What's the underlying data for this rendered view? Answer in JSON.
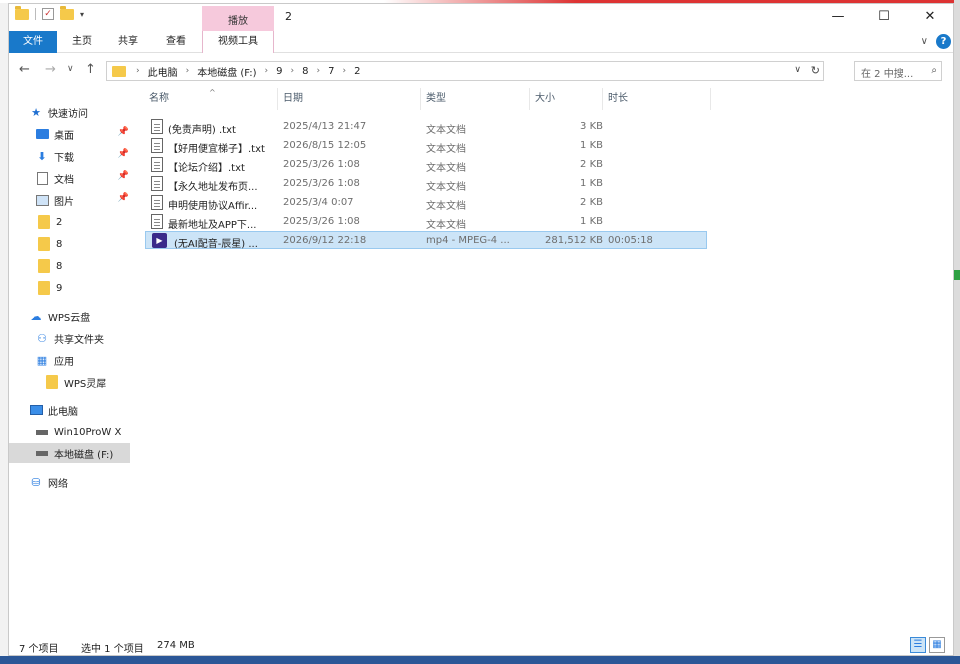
{
  "titlebar": {
    "tool_tab_header": "播放",
    "title": "2",
    "minimize": "—",
    "maximize": "☐",
    "close": "✕"
  },
  "ribbon": {
    "tabs": [
      {
        "label": "文件",
        "kind": "file"
      },
      {
        "label": "主页",
        "kind": "normal"
      },
      {
        "label": "共享",
        "kind": "normal"
      },
      {
        "label": "查看",
        "kind": "normal"
      },
      {
        "label": "视频工具",
        "kind": "tool"
      }
    ],
    "collapse_chevron": "∨",
    "help": "?"
  },
  "navbar": {
    "back": "←",
    "forward": "→",
    "recent": "∨",
    "up": "↑",
    "breadcrumb": [
      "此电脑",
      "本地磁盘 (F:)",
      "9",
      "8",
      "7",
      "2"
    ],
    "search_placeholder": "在 2 中搜..."
  },
  "sidebar": {
    "items": [
      {
        "label": "快速访问",
        "icon": "star-icon",
        "pinned": false,
        "indent": 0
      },
      {
        "label": "桌面",
        "icon": "desktop-icon",
        "pinned": true,
        "indent": 1
      },
      {
        "label": "下载",
        "icon": "download-icon",
        "pinned": true,
        "indent": 1
      },
      {
        "label": "文档",
        "icon": "document-icon",
        "pinned": true,
        "indent": 1
      },
      {
        "label": "图片",
        "icon": "picture-icon",
        "pinned": true,
        "indent": 1
      },
      {
        "label": "2",
        "icon": "folder-icon",
        "pinned": false,
        "indent": 1
      },
      {
        "label": "8",
        "icon": "folder-icon",
        "pinned": false,
        "indent": 1
      },
      {
        "label": "8",
        "icon": "folder-icon",
        "pinned": false,
        "indent": 1
      },
      {
        "label": "9",
        "icon": "folder-icon",
        "pinned": false,
        "indent": 1
      },
      {
        "label": "WPS云盘",
        "icon": "cloud-icon",
        "pinned": false,
        "indent": 0
      },
      {
        "label": "共享文件夹",
        "icon": "share-icon",
        "pinned": false,
        "indent": 1
      },
      {
        "label": "应用",
        "icon": "apps-icon",
        "pinned": false,
        "indent": 1
      },
      {
        "label": "WPS灵犀",
        "icon": "folder-icon",
        "pinned": false,
        "indent": 2
      },
      {
        "label": "此电脑",
        "icon": "computer-icon",
        "pinned": false,
        "indent": 0
      },
      {
        "label": "Win10ProW X",
        "icon": "drive-icon",
        "pinned": false,
        "indent": 1
      },
      {
        "label": "本地磁盘 (F:)",
        "icon": "drive-icon",
        "pinned": false,
        "indent": 1,
        "selected": true
      },
      {
        "label": "网络",
        "icon": "network-icon",
        "pinned": false,
        "indent": 0
      }
    ]
  },
  "columns": [
    {
      "key": "name",
      "label": "名称"
    },
    {
      "key": "date",
      "label": "日期"
    },
    {
      "key": "type",
      "label": "类型"
    },
    {
      "key": "size",
      "label": "大小"
    },
    {
      "key": "duration",
      "label": "时长"
    }
  ],
  "sort_indicator": "^",
  "files": [
    {
      "name": "(免责声明) .txt",
      "date": "2025/4/13 21:47",
      "type": "文本文档",
      "size": "3 KB",
      "duration": "",
      "kind": "text"
    },
    {
      "name": "【好用便宜梯子】.txt",
      "date": "2026/8/15 12:05",
      "type": "文本文档",
      "size": "1 KB",
      "duration": "",
      "kind": "text"
    },
    {
      "name": "【论坛介绍】.txt",
      "date": "2025/3/26 1:08",
      "type": "文本文档",
      "size": "2 KB",
      "duration": "",
      "kind": "text"
    },
    {
      "name": "【永久地址发布页...",
      "date": "2025/3/26 1:08",
      "type": "文本文档",
      "size": "1 KB",
      "duration": "",
      "kind": "text"
    },
    {
      "name": "申明使用协议Affir...",
      "date": "2025/3/4 0:07",
      "type": "文本文档",
      "size": "2 KB",
      "duration": "",
      "kind": "text"
    },
    {
      "name": "最新地址及APP下...",
      "date": "2025/3/26 1:08",
      "type": "文本文档",
      "size": "1 KB",
      "duration": "",
      "kind": "text"
    },
    {
      "name": "(无AI配音-辰星) ...",
      "date": "2026/9/12 22:18",
      "type": "mp4 - MPEG-4 ...",
      "size": "281,512 KB",
      "duration": "00:05:18",
      "kind": "video",
      "selected": true
    }
  ],
  "status": {
    "count": "7 个项目",
    "selected": "选中 1 个项目",
    "size": "274 MB"
  },
  "view_buttons": {
    "details": "☰",
    "icons": "▦"
  }
}
